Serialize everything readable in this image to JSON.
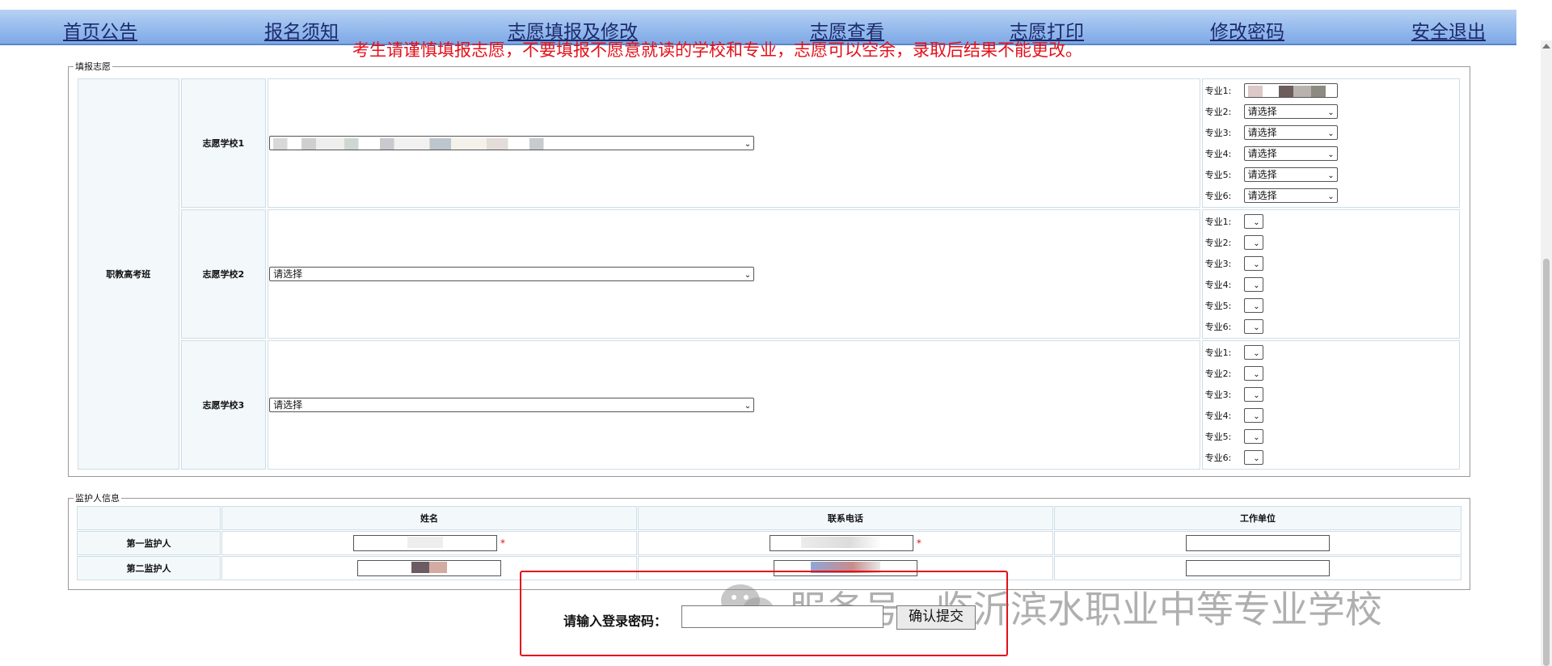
{
  "nav": {
    "items": [
      "首页公告",
      "报名须知",
      "志愿填报及修改",
      "志愿查看",
      "志愿打印",
      "修改密码",
      "安全退出"
    ]
  },
  "notice": "考生请谨慎填报志愿，不要填报不愿意就读的学校和专业，志愿可以空余，录取后结果不能更改。",
  "fill_section": {
    "legend": "填报志愿",
    "category": "职教高考班",
    "schools": [
      {
        "label": "志愿学校1",
        "selected": "",
        "majors": [
          {
            "label": "专业1:",
            "value": ""
          },
          {
            "label": "专业2:",
            "value": "请选择"
          },
          {
            "label": "专业3:",
            "value": "请选择"
          },
          {
            "label": "专业4:",
            "value": "请选择"
          },
          {
            "label": "专业5:",
            "value": "请选择"
          },
          {
            "label": "专业6:",
            "value": "请选择"
          }
        ]
      },
      {
        "label": "志愿学校2",
        "selected": "请选择",
        "majors": [
          {
            "label": "专业1:",
            "value": ""
          },
          {
            "label": "专业2:",
            "value": ""
          },
          {
            "label": "专业3:",
            "value": ""
          },
          {
            "label": "专业4:",
            "value": ""
          },
          {
            "label": "专业5:",
            "value": ""
          },
          {
            "label": "专业6:",
            "value": ""
          }
        ]
      },
      {
        "label": "志愿学校3",
        "selected": "请选择",
        "majors": [
          {
            "label": "专业1:",
            "value": ""
          },
          {
            "label": "专业2:",
            "value": ""
          },
          {
            "label": "专业3:",
            "value": ""
          },
          {
            "label": "专业4:",
            "value": ""
          },
          {
            "label": "专业5:",
            "value": ""
          },
          {
            "label": "专业6:",
            "value": ""
          }
        ]
      }
    ]
  },
  "guardian_section": {
    "legend": "监护人信息",
    "headers": [
      "姓名",
      "联系电话",
      "工作单位"
    ],
    "rows": [
      {
        "label": "第一监护人",
        "required": "*"
      },
      {
        "label": "第二监护人"
      }
    ]
  },
  "password": {
    "label": "请输入登录密码：",
    "value": "",
    "submit": "确认提交"
  },
  "watermark": "服务号 · 临沂滨水职业中等专业学校",
  "colors": {
    "accent_red": "#e3101a",
    "nav_text": "#1c2a6b"
  }
}
